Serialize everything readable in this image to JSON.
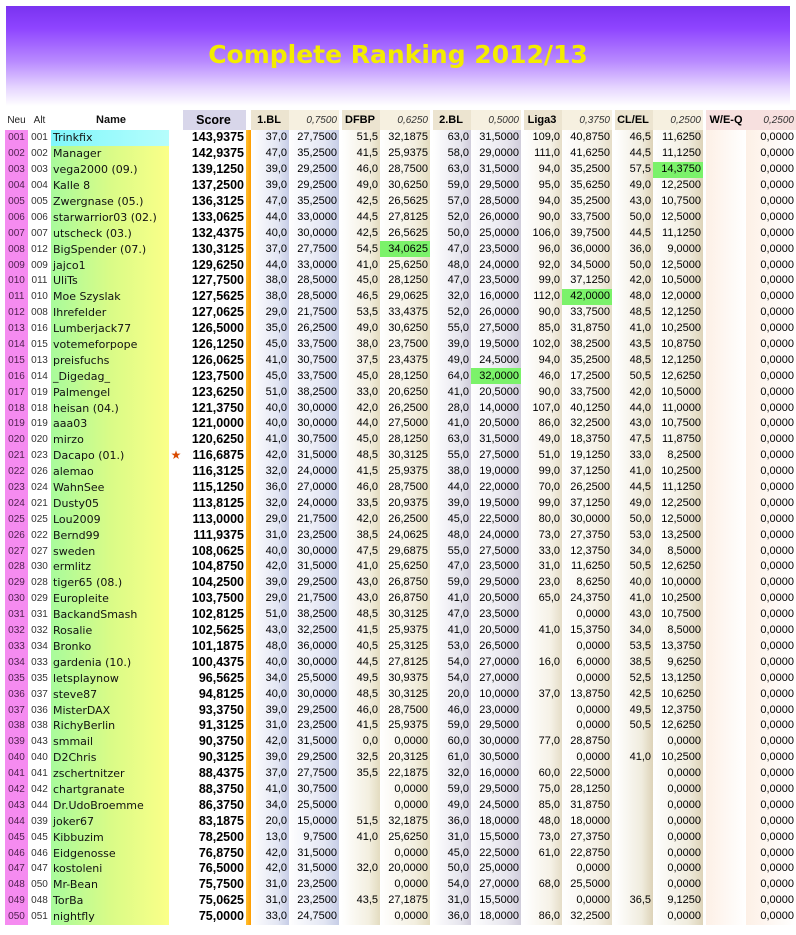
{
  "title": "Complete Ranking 2012/13",
  "headers": {
    "neu": "Neu",
    "alt": "Alt",
    "name": "Name",
    "score": "Score",
    "cols": [
      {
        "label": "1.BL",
        "weight": "0,7500"
      },
      {
        "label": "DFBP",
        "weight": "0,6250"
      },
      {
        "label": "2.BL",
        "weight": "0,5000"
      },
      {
        "label": "Liga3",
        "weight": "0,3750"
      },
      {
        "label": "CL/EL",
        "weight": "0,2500"
      },
      {
        "label": "W/E-Q",
        "weight": "0,2500"
      }
    ]
  },
  "colors": {
    "accent_title": "#f3ec00",
    "banner": "#8e44ff",
    "neu_col": "#f58bf0",
    "highlight": "#7bf26a"
  },
  "rows": [
    {
      "neu": "001",
      "alt": "001",
      "name": "Trinkfix",
      "star": "",
      "score": "143,9375",
      "v": [
        "37,0",
        "27,7500",
        "51,5",
        "32,1875",
        "63,0",
        "31,5000",
        "109,0",
        "40,8750",
        "46,5",
        "11,6250",
        "",
        "0,0000"
      ]
    },
    {
      "neu": "002",
      "alt": "002",
      "name": "Manager",
      "star": "",
      "score": "142,9375",
      "v": [
        "47,0",
        "35,2500",
        "41,5",
        "25,9375",
        "58,0",
        "29,0000",
        "111,0",
        "41,6250",
        "44,5",
        "11,1250",
        "",
        "0,0000"
      ]
    },
    {
      "neu": "003",
      "alt": "003",
      "name": "vega2000 (09.)",
      "star": "",
      "score": "139,1250",
      "v": [
        "39,0",
        "29,2500",
        "46,0",
        "28,7500",
        "63,0",
        "31,5000",
        "94,0",
        "35,2500",
        "57,5",
        "14,3750",
        "",
        "0,0000"
      ]
    },
    {
      "neu": "004",
      "alt": "004",
      "name": "Kalle 8",
      "star": "",
      "score": "137,2500",
      "v": [
        "39,0",
        "29,2500",
        "49,0",
        "30,6250",
        "59,0",
        "29,5000",
        "95,0",
        "35,6250",
        "49,0",
        "12,2500",
        "",
        "0,0000"
      ]
    },
    {
      "neu": "005",
      "alt": "005",
      "name": "Zwergnase (05.)",
      "star": "",
      "score": "136,3125",
      "v": [
        "47,0",
        "35,2500",
        "42,5",
        "26,5625",
        "57,0",
        "28,5000",
        "94,0",
        "35,2500",
        "43,0",
        "10,7500",
        "",
        "0,0000"
      ]
    },
    {
      "neu": "006",
      "alt": "006",
      "name": "starwarrior03 (02.)",
      "star": "",
      "score": "133,0625",
      "v": [
        "44,0",
        "33,0000",
        "44,5",
        "27,8125",
        "52,0",
        "26,0000",
        "90,0",
        "33,7500",
        "50,0",
        "12,5000",
        "",
        "0,0000"
      ]
    },
    {
      "neu": "007",
      "alt": "007",
      "name": "utscheck (03.)",
      "star": "",
      "score": "132,4375",
      "v": [
        "40,0",
        "30,0000",
        "42,5",
        "26,5625",
        "50,0",
        "25,0000",
        "106,0",
        "39,7500",
        "44,5",
        "11,1250",
        "",
        "0,0000"
      ]
    },
    {
      "neu": "008",
      "alt": "012",
      "name": "BigSpender (07.)",
      "star": "",
      "score": "130,3125",
      "v": [
        "37,0",
        "27,7500",
        "54,5",
        "34,0625",
        "47,0",
        "23,5000",
        "96,0",
        "36,0000",
        "36,0",
        "9,0000",
        "",
        "0,0000"
      ]
    },
    {
      "neu": "009",
      "alt": "009",
      "name": "jajco1",
      "star": "",
      "score": "129,6250",
      "v": [
        "44,0",
        "33,0000",
        "41,0",
        "25,6250",
        "48,0",
        "24,0000",
        "92,0",
        "34,5000",
        "50,0",
        "12,5000",
        "",
        "0,0000"
      ]
    },
    {
      "neu": "010",
      "alt": "011",
      "name": "UliTs",
      "star": "",
      "score": "127,7500",
      "v": [
        "38,0",
        "28,5000",
        "45,0",
        "28,1250",
        "47,0",
        "23,5000",
        "99,0",
        "37,1250",
        "42,0",
        "10,5000",
        "",
        "0,0000"
      ]
    },
    {
      "neu": "011",
      "alt": "010",
      "name": "Moe Szyslak",
      "star": "",
      "score": "127,5625",
      "v": [
        "38,0",
        "28,5000",
        "46,5",
        "29,0625",
        "32,0",
        "16,0000",
        "112,0",
        "42,0000",
        "48,0",
        "12,0000",
        "",
        "0,0000"
      ]
    },
    {
      "neu": "012",
      "alt": "008",
      "name": "Ihrefelder",
      "star": "",
      "score": "127,0625",
      "v": [
        "29,0",
        "21,7500",
        "53,5",
        "33,4375",
        "52,0",
        "26,0000",
        "90,0",
        "33,7500",
        "48,5",
        "12,1250",
        "",
        "0,0000"
      ]
    },
    {
      "neu": "013",
      "alt": "016",
      "name": "Lumberjack77",
      "star": "",
      "score": "126,5000",
      "v": [
        "35,0",
        "26,2500",
        "49,0",
        "30,6250",
        "55,0",
        "27,5000",
        "85,0",
        "31,8750",
        "41,0",
        "10,2500",
        "",
        "0,0000"
      ]
    },
    {
      "neu": "014",
      "alt": "015",
      "name": "votemeforpope",
      "star": "",
      "score": "126,1250",
      "v": [
        "45,0",
        "33,7500",
        "38,0",
        "23,7500",
        "39,0",
        "19,5000",
        "102,0",
        "38,2500",
        "43,5",
        "10,8750",
        "",
        "0,0000"
      ]
    },
    {
      "neu": "015",
      "alt": "013",
      "name": "preisfuchs",
      "star": "",
      "score": "126,0625",
      "v": [
        "41,0",
        "30,7500",
        "37,5",
        "23,4375",
        "49,0",
        "24,5000",
        "94,0",
        "35,2500",
        "48,5",
        "12,1250",
        "",
        "0,0000"
      ]
    },
    {
      "neu": "016",
      "alt": "014",
      "name": "_Digedag_",
      "star": "",
      "score": "123,7500",
      "v": [
        "45,0",
        "33,7500",
        "45,0",
        "28,1250",
        "64,0",
        "32,0000",
        "46,0",
        "17,2500",
        "50,5",
        "12,6250",
        "",
        "0,0000"
      ]
    },
    {
      "neu": "017",
      "alt": "019",
      "name": "Palmengel",
      "star": "",
      "score": "123,6250",
      "v": [
        "51,0",
        "38,2500",
        "33,0",
        "20,6250",
        "41,0",
        "20,5000",
        "90,0",
        "33,7500",
        "42,0",
        "10,5000",
        "",
        "0,0000"
      ]
    },
    {
      "neu": "018",
      "alt": "018",
      "name": "heisan (04.)",
      "star": "",
      "score": "121,3750",
      "v": [
        "40,0",
        "30,0000",
        "42,0",
        "26,2500",
        "28,0",
        "14,0000",
        "107,0",
        "40,1250",
        "44,0",
        "11,0000",
        "",
        "0,0000"
      ]
    },
    {
      "neu": "019",
      "alt": "019",
      "name": "aaa03",
      "star": "",
      "score": "121,0000",
      "v": [
        "40,0",
        "30,0000",
        "44,0",
        "27,5000",
        "41,0",
        "20,5000",
        "86,0",
        "32,2500",
        "43,0",
        "10,7500",
        "",
        "0,0000"
      ]
    },
    {
      "neu": "020",
      "alt": "020",
      "name": "mirzo",
      "star": "",
      "score": "120,6250",
      "v": [
        "41,0",
        "30,7500",
        "45,0",
        "28,1250",
        "63,0",
        "31,5000",
        "49,0",
        "18,3750",
        "47,5",
        "11,8750",
        "",
        "0,0000"
      ]
    },
    {
      "neu": "021",
      "alt": "023",
      "name": "Dacapo (01.)",
      "star": "★",
      "score": "116,6875",
      "v": [
        "42,0",
        "31,5000",
        "48,5",
        "30,3125",
        "55,0",
        "27,5000",
        "51,0",
        "19,1250",
        "33,0",
        "8,2500",
        "",
        "0,0000"
      ]
    },
    {
      "neu": "022",
      "alt": "026",
      "name": "alemao",
      "star": "",
      "score": "116,3125",
      "v": [
        "32,0",
        "24,0000",
        "41,5",
        "25,9375",
        "38,0",
        "19,0000",
        "99,0",
        "37,1250",
        "41,0",
        "10,2500",
        "",
        "0,0000"
      ]
    },
    {
      "neu": "023",
      "alt": "024",
      "name": "WahnSee",
      "star": "",
      "score": "115,1250",
      "v": [
        "36,0",
        "27,0000",
        "46,0",
        "28,7500",
        "44,0",
        "22,0000",
        "70,0",
        "26,2500",
        "44,5",
        "11,1250",
        "",
        "0,0000"
      ]
    },
    {
      "neu": "024",
      "alt": "021",
      "name": "Dusty05",
      "star": "",
      "score": "113,8125",
      "v": [
        "32,0",
        "24,0000",
        "33,5",
        "20,9375",
        "39,0",
        "19,5000",
        "99,0",
        "37,1250",
        "49,0",
        "12,2500",
        "",
        "0,0000"
      ]
    },
    {
      "neu": "025",
      "alt": "025",
      "name": "Lou2009",
      "star": "",
      "score": "113,0000",
      "v": [
        "29,0",
        "21,7500",
        "42,0",
        "26,2500",
        "45,0",
        "22,5000",
        "80,0",
        "30,0000",
        "50,0",
        "12,5000",
        "",
        "0,0000"
      ]
    },
    {
      "neu": "026",
      "alt": "022",
      "name": "Bernd99",
      "star": "",
      "score": "111,9375",
      "v": [
        "31,0",
        "23,2500",
        "38,5",
        "24,0625",
        "48,0",
        "24,0000",
        "73,0",
        "27,3750",
        "53,0",
        "13,2500",
        "",
        "0,0000"
      ]
    },
    {
      "neu": "027",
      "alt": "027",
      "name": "sweden",
      "star": "",
      "score": "108,0625",
      "v": [
        "40,0",
        "30,0000",
        "47,5",
        "29,6875",
        "55,0",
        "27,5000",
        "33,0",
        "12,3750",
        "34,0",
        "8,5000",
        "",
        "0,0000"
      ]
    },
    {
      "neu": "028",
      "alt": "030",
      "name": "ermlitz",
      "star": "",
      "score": "104,8750",
      "v": [
        "42,0",
        "31,5000",
        "41,0",
        "25,6250",
        "47,0",
        "23,5000",
        "31,0",
        "11,6250",
        "50,5",
        "12,6250",
        "",
        "0,0000"
      ]
    },
    {
      "neu": "029",
      "alt": "028",
      "name": "tiger65 (08.)",
      "star": "",
      "score": "104,2500",
      "v": [
        "39,0",
        "29,2500",
        "43,0",
        "26,8750",
        "59,0",
        "29,5000",
        "23,0",
        "8,6250",
        "40,0",
        "10,0000",
        "",
        "0,0000"
      ]
    },
    {
      "neu": "030",
      "alt": "029",
      "name": "Europleite",
      "star": "",
      "score": "103,7500",
      "v": [
        "29,0",
        "21,7500",
        "43,0",
        "26,8750",
        "41,0",
        "20,5000",
        "65,0",
        "24,3750",
        "41,0",
        "10,2500",
        "",
        "0,0000"
      ]
    },
    {
      "neu": "031",
      "alt": "031",
      "name": "BackandSmash",
      "star": "",
      "score": "102,8125",
      "v": [
        "51,0",
        "38,2500",
        "48,5",
        "30,3125",
        "47,0",
        "23,5000",
        "",
        "0,0000",
        "43,0",
        "10,7500",
        "",
        "0,0000"
      ]
    },
    {
      "neu": "032",
      "alt": "032",
      "name": "Rosalie",
      "star": "",
      "score": "102,5625",
      "v": [
        "43,0",
        "32,2500",
        "41,5",
        "25,9375",
        "41,0",
        "20,5000",
        "41,0",
        "15,3750",
        "34,0",
        "8,5000",
        "",
        "0,0000"
      ]
    },
    {
      "neu": "033",
      "alt": "034",
      "name": "Bronko",
      "star": "",
      "score": "101,1875",
      "v": [
        "48,0",
        "36,0000",
        "40,5",
        "25,3125",
        "53,0",
        "26,5000",
        "",
        "0,0000",
        "53,5",
        "13,3750",
        "",
        "0,0000"
      ]
    },
    {
      "neu": "034",
      "alt": "033",
      "name": "gardenia (10.)",
      "star": "",
      "score": "100,4375",
      "v": [
        "40,0",
        "30,0000",
        "44,5",
        "27,8125",
        "54,0",
        "27,0000",
        "16,0",
        "6,0000",
        "38,5",
        "9,6250",
        "",
        "0,0000"
      ]
    },
    {
      "neu": "035",
      "alt": "035",
      "name": "letsplaynow",
      "star": "",
      "score": "96,5625",
      "v": [
        "34,0",
        "25,5000",
        "49,5",
        "30,9375",
        "54,0",
        "27,0000",
        "",
        "0,0000",
        "52,5",
        "13,1250",
        "",
        "0,0000"
      ]
    },
    {
      "neu": "036",
      "alt": "037",
      "name": "steve87",
      "star": "",
      "score": "94,8125",
      "v": [
        "40,0",
        "30,0000",
        "48,5",
        "30,3125",
        "20,0",
        "10,0000",
        "37,0",
        "13,8750",
        "42,5",
        "10,6250",
        "",
        "0,0000"
      ]
    },
    {
      "neu": "037",
      "alt": "036",
      "name": "MisterDAX",
      "star": "",
      "score": "93,3750",
      "v": [
        "39,0",
        "29,2500",
        "46,0",
        "28,7500",
        "46,0",
        "23,0000",
        "",
        "0,0000",
        "49,5",
        "12,3750",
        "",
        "0,0000"
      ]
    },
    {
      "neu": "038",
      "alt": "038",
      "name": "RichyBerlin",
      "star": "",
      "score": "91,3125",
      "v": [
        "31,0",
        "23,2500",
        "41,5",
        "25,9375",
        "59,0",
        "29,5000",
        "",
        "0,0000",
        "50,5",
        "12,6250",
        "",
        "0,0000"
      ]
    },
    {
      "neu": "039",
      "alt": "043",
      "name": "smmail",
      "star": "",
      "score": "90,3750",
      "v": [
        "42,0",
        "31,5000",
        "0,0",
        "0,0000",
        "60,0",
        "30,0000",
        "77,0",
        "28,8750",
        "",
        "0,0000",
        "",
        "0,0000"
      ]
    },
    {
      "neu": "040",
      "alt": "040",
      "name": "D2Chris",
      "star": "",
      "score": "90,3125",
      "v": [
        "39,0",
        "29,2500",
        "32,5",
        "20,3125",
        "61,0",
        "30,5000",
        "",
        "0,0000",
        "41,0",
        "10,2500",
        "",
        "0,0000"
      ]
    },
    {
      "neu": "041",
      "alt": "041",
      "name": "zschertnitzer",
      "star": "",
      "score": "88,4375",
      "v": [
        "37,0",
        "27,7500",
        "35,5",
        "22,1875",
        "32,0",
        "16,0000",
        "60,0",
        "22,5000",
        "",
        "0,0000",
        "",
        "0,0000"
      ]
    },
    {
      "neu": "042",
      "alt": "042",
      "name": "chartgranate",
      "star": "",
      "score": "88,3750",
      "v": [
        "41,0",
        "30,7500",
        "",
        "0,0000",
        "59,0",
        "29,5000",
        "75,0",
        "28,1250",
        "",
        "0,0000",
        "",
        "0,0000"
      ]
    },
    {
      "neu": "043",
      "alt": "044",
      "name": "Dr.UdoBroemme",
      "star": "",
      "score": "86,3750",
      "v": [
        "34,0",
        "25,5000",
        "",
        "0,0000",
        "49,0",
        "24,5000",
        "85,0",
        "31,8750",
        "",
        "0,0000",
        "",
        "0,0000"
      ]
    },
    {
      "neu": "044",
      "alt": "039",
      "name": "joker67",
      "star": "",
      "score": "83,1875",
      "v": [
        "20,0",
        "15,0000",
        "51,5",
        "32,1875",
        "36,0",
        "18,0000",
        "48,0",
        "18,0000",
        "",
        "0,0000",
        "",
        "0,0000"
      ]
    },
    {
      "neu": "045",
      "alt": "045",
      "name": "Kibbuzim",
      "star": "",
      "score": "78,2500",
      "v": [
        "13,0",
        "9,7500",
        "41,0",
        "25,6250",
        "31,0",
        "15,5000",
        "73,0",
        "27,3750",
        "",
        "0,0000",
        "",
        "0,0000"
      ]
    },
    {
      "neu": "046",
      "alt": "046",
      "name": "Eidgenosse",
      "star": "",
      "score": "76,8750",
      "v": [
        "42,0",
        "31,5000",
        "",
        "0,0000",
        "45,0",
        "22,5000",
        "61,0",
        "22,8750",
        "",
        "0,0000",
        "",
        "0,0000"
      ]
    },
    {
      "neu": "047",
      "alt": "047",
      "name": "kostoleni",
      "star": "",
      "score": "76,5000",
      "v": [
        "42,0",
        "31,5000",
        "32,0",
        "20,0000",
        "50,0",
        "25,0000",
        "",
        "0,0000",
        "",
        "0,0000",
        "",
        "0,0000"
      ]
    },
    {
      "neu": "048",
      "alt": "050",
      "name": "Mr-Bean",
      "star": "",
      "score": "75,7500",
      "v": [
        "31,0",
        "23,2500",
        "",
        "0,0000",
        "54,0",
        "27,0000",
        "68,0",
        "25,5000",
        "",
        "0,0000",
        "",
        "0,0000"
      ]
    },
    {
      "neu": "049",
      "alt": "048",
      "name": "TorBa",
      "star": "",
      "score": "75,0625",
      "v": [
        "31,0",
        "23,2500",
        "43,5",
        "27,1875",
        "31,0",
        "15,5000",
        "",
        "0,0000",
        "36,5",
        "9,1250",
        "",
        "0,0000"
      ]
    },
    {
      "neu": "050",
      "alt": "051",
      "name": "nightfly",
      "star": "",
      "score": "75,0000",
      "v": [
        "33,0",
        "24,7500",
        "",
        "0,0000",
        "36,0",
        "18,0000",
        "86,0",
        "32,2500",
        "",
        "0,0000",
        "",
        "0,0000"
      ]
    }
  ]
}
